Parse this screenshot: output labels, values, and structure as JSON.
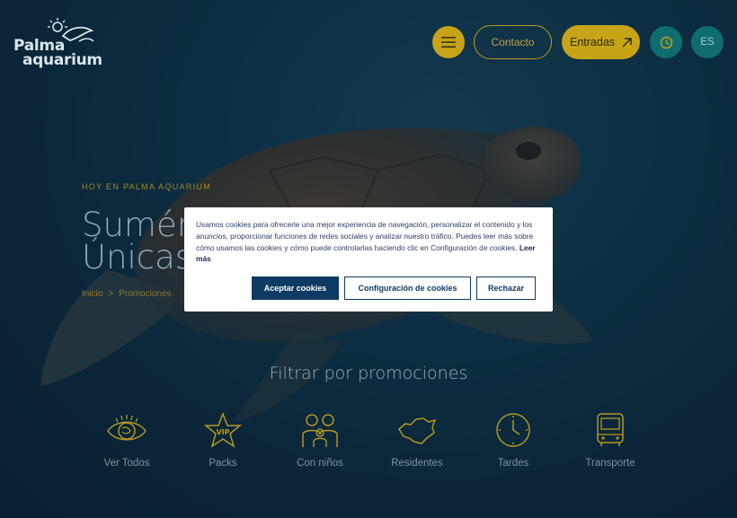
{
  "brand": {
    "logo_line1": "Palma",
    "logo_line2": "aquarium"
  },
  "header": {
    "contact_label": "Contacto",
    "tickets_label": "Entradas",
    "language": "ES"
  },
  "hero": {
    "eyebrow": "HOY EN PALMA AQUARIUM",
    "headline": "Sumér\nÚnicas",
    "breadcrumb": [
      "Inicio",
      ">",
      "Promociones"
    ]
  },
  "filter": {
    "title": "Filtrar por promociones",
    "categories": [
      {
        "label": "Ver Todos",
        "icon": "eye-icon"
      },
      {
        "label": "Packs",
        "icon": "vip-star-icon"
      },
      {
        "label": "Con niños",
        "icon": "family-icon"
      },
      {
        "label": "Residentes",
        "icon": "island-map-icon"
      },
      {
        "label": "Tardes",
        "icon": "clock-icon"
      },
      {
        "label": "Transporte",
        "icon": "bus-icon"
      }
    ]
  },
  "cookie_banner": {
    "text": "Usamos cookies para ofrecerle una mejor experiencia de navegación, personalizar el contenido y los anuncios, proporcionar funciones de redes sociales y analizar nuestro tráfico. Puedes leer más sobre cómo usamos las cookies y cómo puede controlarlas haciendo clic en Configuración de cookies.",
    "read_more": "Leer más",
    "accept_label": "Aceptar cookies",
    "settings_label": "Configuración de cookies",
    "reject_label": "Rechazar"
  },
  "colors": {
    "accent": "#c7a417",
    "teal": "#0f6d6f",
    "navy": "#0d3b63",
    "background": "#0d2a3b"
  }
}
